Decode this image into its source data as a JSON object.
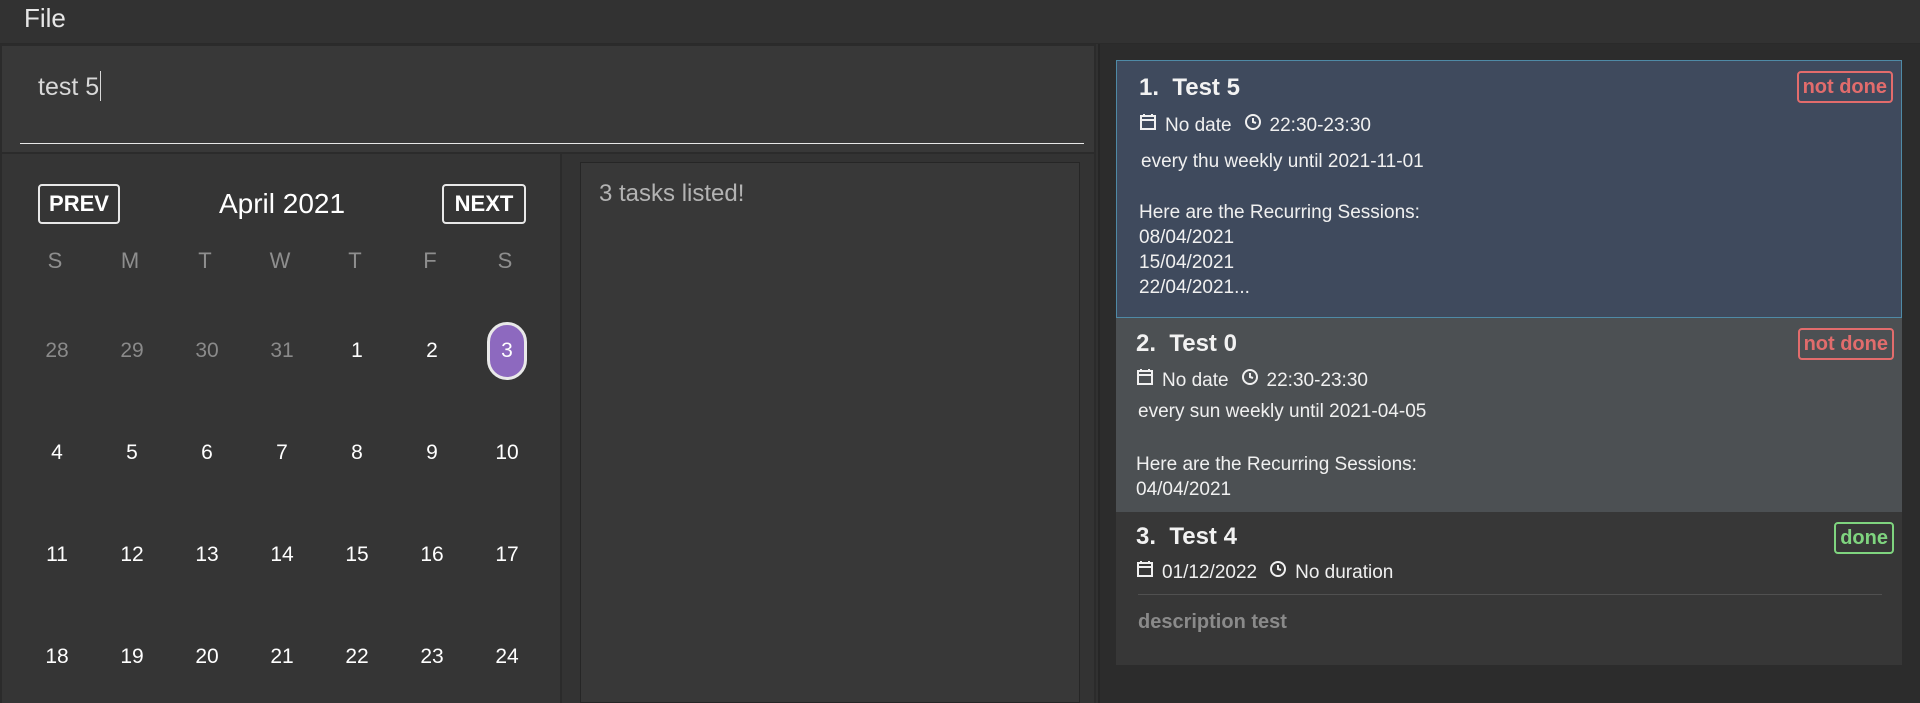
{
  "menu": {
    "file": "File"
  },
  "command": {
    "value": "test 5"
  },
  "calendar": {
    "prev_label": "PREV",
    "next_label": "NEXT",
    "month_title": "April 2021",
    "weekdays": [
      "S",
      "M",
      "T",
      "W",
      "T",
      "F",
      "S"
    ],
    "weeks": [
      [
        "28",
        "29",
        "30",
        "31",
        "1",
        "2",
        "3"
      ],
      [
        "4",
        "5",
        "6",
        "7",
        "8",
        "9",
        "10"
      ],
      [
        "11",
        "12",
        "13",
        "14",
        "15",
        "16",
        "17"
      ],
      [
        "18",
        "19",
        "20",
        "21",
        "22",
        "23",
        "24"
      ]
    ],
    "selected_day": "3",
    "accent_color": "#8d69bf"
  },
  "result": {
    "message": "3 tasks listed!"
  },
  "tasks": [
    {
      "index": "1.",
      "title": "Test 5",
      "status": "not done",
      "date": "No date",
      "time": "22:30-23:30",
      "recurrence": "every thu weekly until 2021-11-01",
      "sessions_header": "Here are the Recurring Sessions:",
      "sessions": [
        "08/04/2021",
        "15/04/2021",
        "22/04/2021..."
      ]
    },
    {
      "index": "2.",
      "title": "Test 0",
      "status": "not done",
      "date": "No date",
      "time": "22:30-23:30",
      "recurrence": "every sun weekly until 2021-04-05",
      "sessions_header": "Here are the Recurring Sessions:",
      "sessions": [
        "04/04/2021"
      ]
    },
    {
      "index": "3.",
      "title": "Test 4",
      "status": "done",
      "date": "01/12/2022",
      "time": "No duration",
      "description": "description test"
    }
  ],
  "colors": {
    "not_done": "#e26c6c",
    "done": "#7fd47f",
    "selected_card": "#3f4a5d"
  },
  "icons": {
    "date": "calendar-icon",
    "time": "clock-icon"
  }
}
